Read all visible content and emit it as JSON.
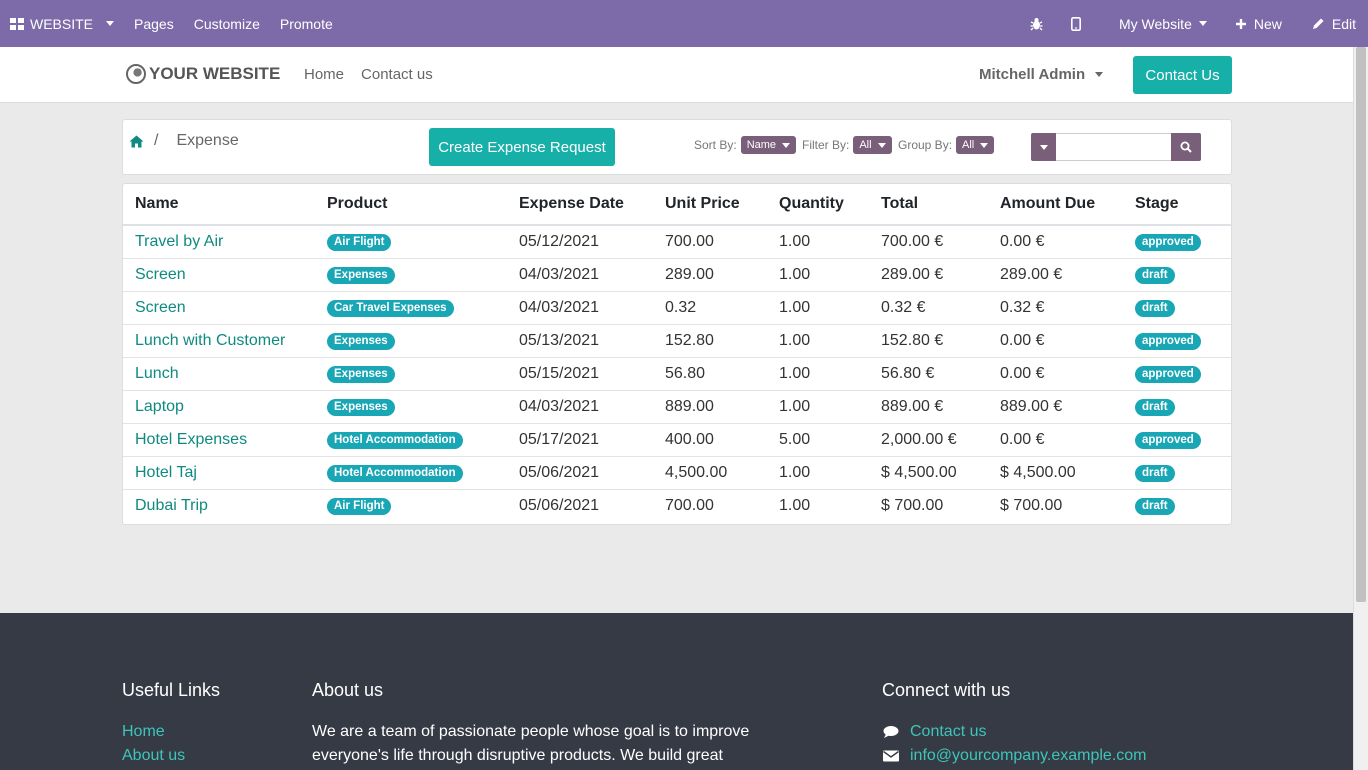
{
  "adminbar": {
    "brand": "WEBSITE",
    "menu": [
      "Pages",
      "Customize",
      "Promote"
    ],
    "site_switch": "My Website",
    "new_label": "New",
    "edit_label": "Edit"
  },
  "header": {
    "logo_text": "YOUR WEBSITE",
    "nav": [
      "Home",
      "Contact us"
    ],
    "user": "Mitchell Admin",
    "contact_button": "Contact Us"
  },
  "controls": {
    "breadcrumb_sep": "/",
    "breadcrumb_current": "Expense",
    "create_button": "Create Expense Request",
    "sort_label": "Sort By:",
    "sort_value": "Name",
    "filter_label": "Filter By:",
    "filter_value": "All",
    "group_label": "Group By:",
    "group_value": "All",
    "search_placeholder": ""
  },
  "table": {
    "columns": [
      "Name",
      "Product",
      "Expense Date",
      "Unit Price",
      "Quantity",
      "Total",
      "Amount Due",
      "Stage"
    ],
    "rows": [
      {
        "name": "Travel by Air",
        "product": "Air Flight",
        "date": "05/12/2021",
        "unit_price": "700.00",
        "qty": "1.00",
        "total": "700.00 €",
        "due": "0.00 €",
        "stage": "approved"
      },
      {
        "name": "Screen",
        "product": "Expenses",
        "date": "04/03/2021",
        "unit_price": "289.00",
        "qty": "1.00",
        "total": "289.00 €",
        "due": "289.00 €",
        "stage": "draft"
      },
      {
        "name": "Screen",
        "product": "Car Travel Expenses",
        "date": "04/03/2021",
        "unit_price": "0.32",
        "qty": "1.00",
        "total": "0.32 €",
        "due": "0.32 €",
        "stage": "draft"
      },
      {
        "name": "Lunch with Customer",
        "product": "Expenses",
        "date": "05/13/2021",
        "unit_price": "152.80",
        "qty": "1.00",
        "total": "152.80 €",
        "due": "0.00 €",
        "stage": "approved"
      },
      {
        "name": "Lunch",
        "product": "Expenses",
        "date": "05/15/2021",
        "unit_price": "56.80",
        "qty": "1.00",
        "total": "56.80 €",
        "due": "0.00 €",
        "stage": "approved"
      },
      {
        "name": "Laptop",
        "product": "Expenses",
        "date": "04/03/2021",
        "unit_price": "889.00",
        "qty": "1.00",
        "total": "889.00 €",
        "due": "889.00 €",
        "stage": "draft"
      },
      {
        "name": "Hotel Expenses",
        "product": "Hotel Accommodation",
        "date": "05/17/2021",
        "unit_price": "400.00",
        "qty": "5.00",
        "total": "2,000.00 €",
        "due": "0.00 €",
        "stage": "approved"
      },
      {
        "name": "Hotel Taj",
        "product": "Hotel Accommodation",
        "date": "05/06/2021",
        "unit_price": "4,500.00",
        "qty": "1.00",
        "total": "$ 4,500.00",
        "due": "$ 4,500.00",
        "stage": "draft"
      },
      {
        "name": "Dubai Trip",
        "product": "Air Flight",
        "date": "05/06/2021",
        "unit_price": "700.00",
        "qty": "1.00",
        "total": "$ 700.00",
        "due": "$ 700.00",
        "stage": "draft"
      }
    ]
  },
  "footer": {
    "useful_links_title": "Useful Links",
    "useful_links": [
      "Home",
      "About us"
    ],
    "about_title": "About us",
    "about_text": "We are a team of passionate people whose goal is to improve everyone's life through disruptive products. We build great",
    "connect_title": "Connect with us",
    "contact_link": "Contact us",
    "email_link": "info@yourcompany.example.com"
  },
  "colors": {
    "adminbar": "#7c6ba8",
    "primary": "#17b0a8",
    "link": "#0f8a80",
    "badge": "#19a6b5",
    "filter_pill": "#7a5f7b",
    "footer": "#363a44"
  }
}
